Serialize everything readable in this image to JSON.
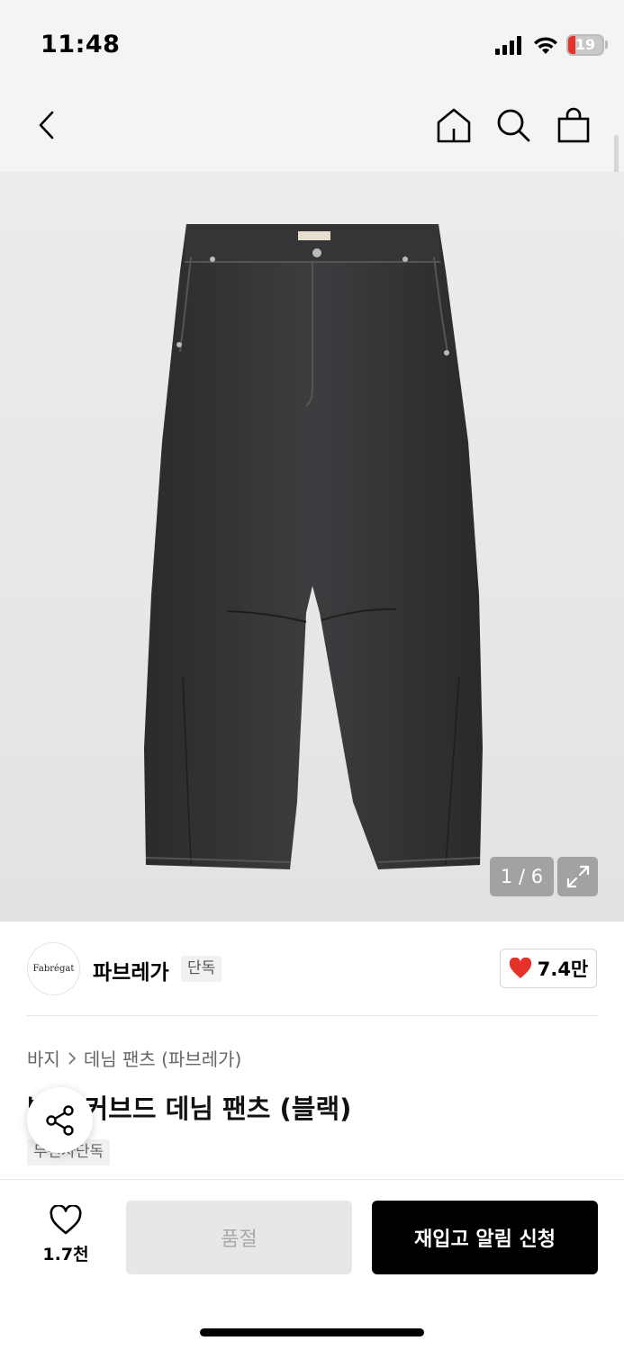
{
  "status_bar": {
    "time": "11:48",
    "battery": "19"
  },
  "nav": {
    "back_icon": "chevron-left-icon",
    "home_icon": "home-icon",
    "search_icon": "search-icon",
    "cart_icon": "shopping-bag-icon"
  },
  "gallery": {
    "counter": "1 / 6",
    "expand_icon": "expand-icon"
  },
  "brand": {
    "logo_text": "Fabrégat",
    "name": "파브레가",
    "tag": "단독",
    "likes": "7.4만"
  },
  "breadcrumb": {
    "category": "바지",
    "subcategory": "데님 팬츠 (파브레가)"
  },
  "product": {
    "title": "발롱 커브드 데님 팬츠 (블랙)",
    "badge": "무신사단독"
  },
  "bottom": {
    "wish_count": "1.7천",
    "soldout_label": "품절",
    "restock_label": "재입고 알림 신청"
  },
  "colors": {
    "accent_red": "#e5322b",
    "primary_black": "#000000",
    "disabled_gray": "#e7e7e7"
  }
}
